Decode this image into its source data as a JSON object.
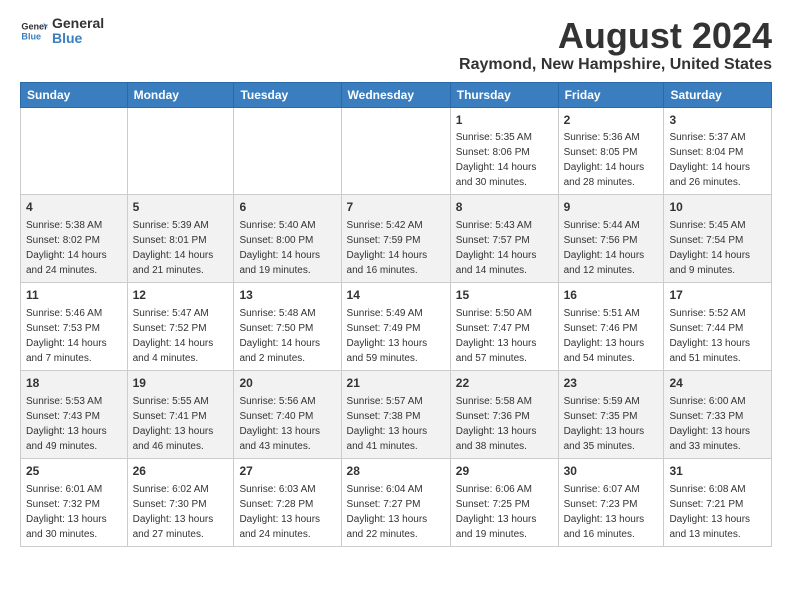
{
  "header": {
    "logo_general": "General",
    "logo_blue": "Blue",
    "month_title": "August 2024",
    "location": "Raymond, New Hampshire, United States"
  },
  "calendar": {
    "headers": [
      "Sunday",
      "Monday",
      "Tuesday",
      "Wednesday",
      "Thursday",
      "Friday",
      "Saturday"
    ],
    "weeks": [
      [
        {
          "day": "",
          "info": ""
        },
        {
          "day": "",
          "info": ""
        },
        {
          "day": "",
          "info": ""
        },
        {
          "day": "",
          "info": ""
        },
        {
          "day": "1",
          "info": "Sunrise: 5:35 AM\nSunset: 8:06 PM\nDaylight: 14 hours\nand 30 minutes."
        },
        {
          "day": "2",
          "info": "Sunrise: 5:36 AM\nSunset: 8:05 PM\nDaylight: 14 hours\nand 28 minutes."
        },
        {
          "day": "3",
          "info": "Sunrise: 5:37 AM\nSunset: 8:04 PM\nDaylight: 14 hours\nand 26 minutes."
        }
      ],
      [
        {
          "day": "4",
          "info": "Sunrise: 5:38 AM\nSunset: 8:02 PM\nDaylight: 14 hours\nand 24 minutes."
        },
        {
          "day": "5",
          "info": "Sunrise: 5:39 AM\nSunset: 8:01 PM\nDaylight: 14 hours\nand 21 minutes."
        },
        {
          "day": "6",
          "info": "Sunrise: 5:40 AM\nSunset: 8:00 PM\nDaylight: 14 hours\nand 19 minutes."
        },
        {
          "day": "7",
          "info": "Sunrise: 5:42 AM\nSunset: 7:59 PM\nDaylight: 14 hours\nand 16 minutes."
        },
        {
          "day": "8",
          "info": "Sunrise: 5:43 AM\nSunset: 7:57 PM\nDaylight: 14 hours\nand 14 minutes."
        },
        {
          "day": "9",
          "info": "Sunrise: 5:44 AM\nSunset: 7:56 PM\nDaylight: 14 hours\nand 12 minutes."
        },
        {
          "day": "10",
          "info": "Sunrise: 5:45 AM\nSunset: 7:54 PM\nDaylight: 14 hours\nand 9 minutes."
        }
      ],
      [
        {
          "day": "11",
          "info": "Sunrise: 5:46 AM\nSunset: 7:53 PM\nDaylight: 14 hours\nand 7 minutes."
        },
        {
          "day": "12",
          "info": "Sunrise: 5:47 AM\nSunset: 7:52 PM\nDaylight: 14 hours\nand 4 minutes."
        },
        {
          "day": "13",
          "info": "Sunrise: 5:48 AM\nSunset: 7:50 PM\nDaylight: 14 hours\nand 2 minutes."
        },
        {
          "day": "14",
          "info": "Sunrise: 5:49 AM\nSunset: 7:49 PM\nDaylight: 13 hours\nand 59 minutes."
        },
        {
          "day": "15",
          "info": "Sunrise: 5:50 AM\nSunset: 7:47 PM\nDaylight: 13 hours\nand 57 minutes."
        },
        {
          "day": "16",
          "info": "Sunrise: 5:51 AM\nSunset: 7:46 PM\nDaylight: 13 hours\nand 54 minutes."
        },
        {
          "day": "17",
          "info": "Sunrise: 5:52 AM\nSunset: 7:44 PM\nDaylight: 13 hours\nand 51 minutes."
        }
      ],
      [
        {
          "day": "18",
          "info": "Sunrise: 5:53 AM\nSunset: 7:43 PM\nDaylight: 13 hours\nand 49 minutes."
        },
        {
          "day": "19",
          "info": "Sunrise: 5:55 AM\nSunset: 7:41 PM\nDaylight: 13 hours\nand 46 minutes."
        },
        {
          "day": "20",
          "info": "Sunrise: 5:56 AM\nSunset: 7:40 PM\nDaylight: 13 hours\nand 43 minutes."
        },
        {
          "day": "21",
          "info": "Sunrise: 5:57 AM\nSunset: 7:38 PM\nDaylight: 13 hours\nand 41 minutes."
        },
        {
          "day": "22",
          "info": "Sunrise: 5:58 AM\nSunset: 7:36 PM\nDaylight: 13 hours\nand 38 minutes."
        },
        {
          "day": "23",
          "info": "Sunrise: 5:59 AM\nSunset: 7:35 PM\nDaylight: 13 hours\nand 35 minutes."
        },
        {
          "day": "24",
          "info": "Sunrise: 6:00 AM\nSunset: 7:33 PM\nDaylight: 13 hours\nand 33 minutes."
        }
      ],
      [
        {
          "day": "25",
          "info": "Sunrise: 6:01 AM\nSunset: 7:32 PM\nDaylight: 13 hours\nand 30 minutes."
        },
        {
          "day": "26",
          "info": "Sunrise: 6:02 AM\nSunset: 7:30 PM\nDaylight: 13 hours\nand 27 minutes."
        },
        {
          "day": "27",
          "info": "Sunrise: 6:03 AM\nSunset: 7:28 PM\nDaylight: 13 hours\nand 24 minutes."
        },
        {
          "day": "28",
          "info": "Sunrise: 6:04 AM\nSunset: 7:27 PM\nDaylight: 13 hours\nand 22 minutes."
        },
        {
          "day": "29",
          "info": "Sunrise: 6:06 AM\nSunset: 7:25 PM\nDaylight: 13 hours\nand 19 minutes."
        },
        {
          "day": "30",
          "info": "Sunrise: 6:07 AM\nSunset: 7:23 PM\nDaylight: 13 hours\nand 16 minutes."
        },
        {
          "day": "31",
          "info": "Sunrise: 6:08 AM\nSunset: 7:21 PM\nDaylight: 13 hours\nand 13 minutes."
        }
      ]
    ]
  }
}
